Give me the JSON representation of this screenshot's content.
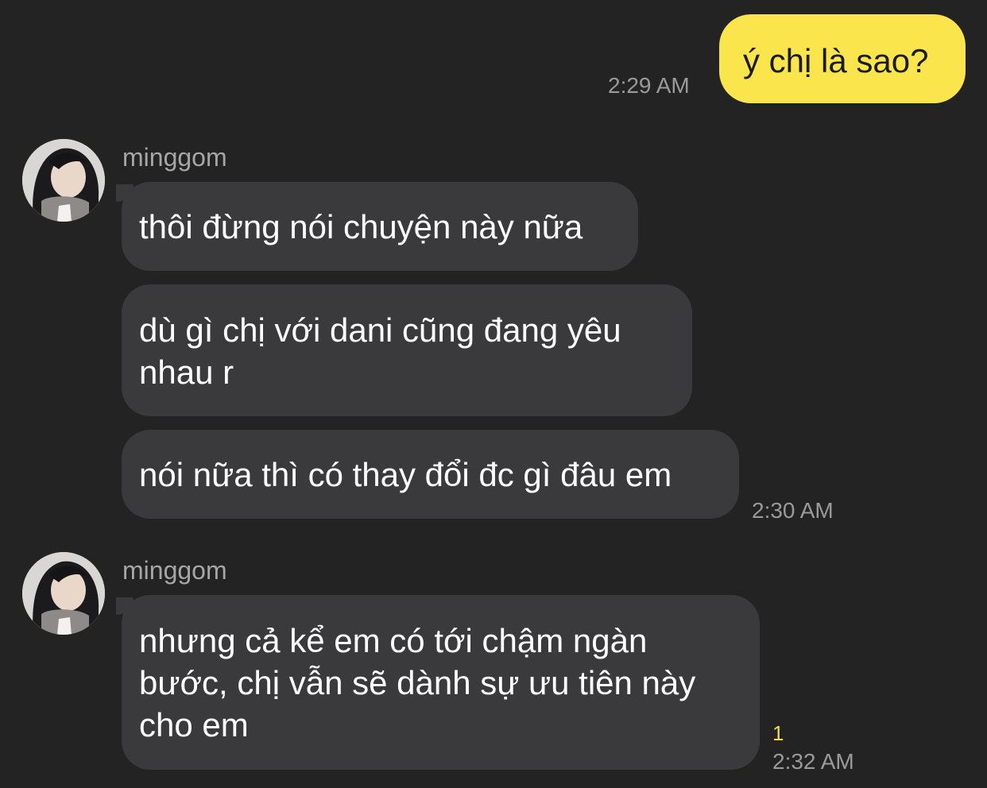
{
  "colors": {
    "background": "#232324",
    "outgoing_bubble": "#fae54c",
    "incoming_bubble": "#3a3a3c",
    "timestamp": "#9a9a9b",
    "unread": "#f5dc3c"
  },
  "outgoing": {
    "text": "ý chị là sao?",
    "time": "2:29 AM"
  },
  "groups": [
    {
      "sender": "minggom",
      "avatar_icon": "profile-photo",
      "messages": [
        "thôi đừng nói chuyện này nữa",
        "dù gì chị với dani cũng đang yêu nhau r",
        "nói nữa thì có thay đổi đc gì đâu em"
      ],
      "time": "2:30 AM"
    },
    {
      "sender": "minggom",
      "avatar_icon": "profile-photo",
      "messages": [
        "nhưng cả kể em có tới chậm ngàn bước, chị vẫn sẽ dành sự ưu tiên này cho em"
      ],
      "unread": "1",
      "time": "2:32 AM"
    }
  ]
}
